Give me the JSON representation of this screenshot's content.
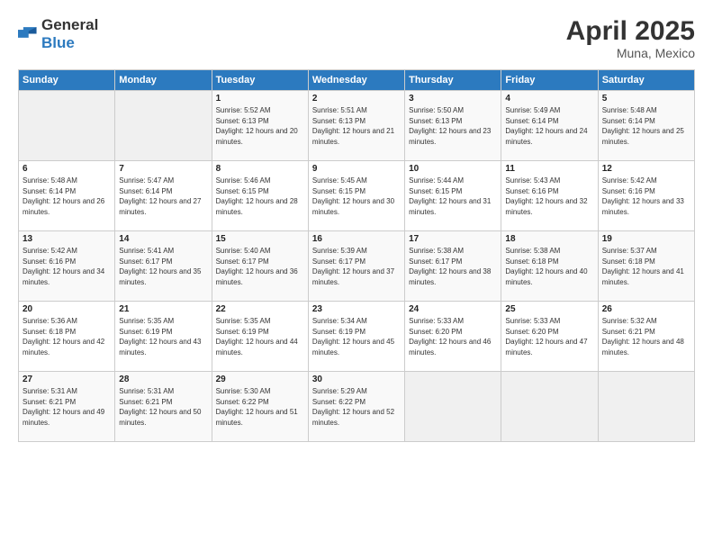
{
  "logo": {
    "general": "General",
    "blue": "Blue"
  },
  "title": {
    "month_year": "April 2025",
    "location": "Muna, Mexico"
  },
  "weekdays": [
    "Sunday",
    "Monday",
    "Tuesday",
    "Wednesday",
    "Thursday",
    "Friday",
    "Saturday"
  ],
  "weeks": [
    [
      null,
      null,
      {
        "day": "1",
        "sunrise": "Sunrise: 5:52 AM",
        "sunset": "Sunset: 6:13 PM",
        "daylight": "Daylight: 12 hours and 20 minutes."
      },
      {
        "day": "2",
        "sunrise": "Sunrise: 5:51 AM",
        "sunset": "Sunset: 6:13 PM",
        "daylight": "Daylight: 12 hours and 21 minutes."
      },
      {
        "day": "3",
        "sunrise": "Sunrise: 5:50 AM",
        "sunset": "Sunset: 6:13 PM",
        "daylight": "Daylight: 12 hours and 23 minutes."
      },
      {
        "day": "4",
        "sunrise": "Sunrise: 5:49 AM",
        "sunset": "Sunset: 6:14 PM",
        "daylight": "Daylight: 12 hours and 24 minutes."
      },
      {
        "day": "5",
        "sunrise": "Sunrise: 5:48 AM",
        "sunset": "Sunset: 6:14 PM",
        "daylight": "Daylight: 12 hours and 25 minutes."
      }
    ],
    [
      {
        "day": "6",
        "sunrise": "Sunrise: 5:48 AM",
        "sunset": "Sunset: 6:14 PM",
        "daylight": "Daylight: 12 hours and 26 minutes."
      },
      {
        "day": "7",
        "sunrise": "Sunrise: 5:47 AM",
        "sunset": "Sunset: 6:14 PM",
        "daylight": "Daylight: 12 hours and 27 minutes."
      },
      {
        "day": "8",
        "sunrise": "Sunrise: 5:46 AM",
        "sunset": "Sunset: 6:15 PM",
        "daylight": "Daylight: 12 hours and 28 minutes."
      },
      {
        "day": "9",
        "sunrise": "Sunrise: 5:45 AM",
        "sunset": "Sunset: 6:15 PM",
        "daylight": "Daylight: 12 hours and 30 minutes."
      },
      {
        "day": "10",
        "sunrise": "Sunrise: 5:44 AM",
        "sunset": "Sunset: 6:15 PM",
        "daylight": "Daylight: 12 hours and 31 minutes."
      },
      {
        "day": "11",
        "sunrise": "Sunrise: 5:43 AM",
        "sunset": "Sunset: 6:16 PM",
        "daylight": "Daylight: 12 hours and 32 minutes."
      },
      {
        "day": "12",
        "sunrise": "Sunrise: 5:42 AM",
        "sunset": "Sunset: 6:16 PM",
        "daylight": "Daylight: 12 hours and 33 minutes."
      }
    ],
    [
      {
        "day": "13",
        "sunrise": "Sunrise: 5:42 AM",
        "sunset": "Sunset: 6:16 PM",
        "daylight": "Daylight: 12 hours and 34 minutes."
      },
      {
        "day": "14",
        "sunrise": "Sunrise: 5:41 AM",
        "sunset": "Sunset: 6:17 PM",
        "daylight": "Daylight: 12 hours and 35 minutes."
      },
      {
        "day": "15",
        "sunrise": "Sunrise: 5:40 AM",
        "sunset": "Sunset: 6:17 PM",
        "daylight": "Daylight: 12 hours and 36 minutes."
      },
      {
        "day": "16",
        "sunrise": "Sunrise: 5:39 AM",
        "sunset": "Sunset: 6:17 PM",
        "daylight": "Daylight: 12 hours and 37 minutes."
      },
      {
        "day": "17",
        "sunrise": "Sunrise: 5:38 AM",
        "sunset": "Sunset: 6:17 PM",
        "daylight": "Daylight: 12 hours and 38 minutes."
      },
      {
        "day": "18",
        "sunrise": "Sunrise: 5:38 AM",
        "sunset": "Sunset: 6:18 PM",
        "daylight": "Daylight: 12 hours and 40 minutes."
      },
      {
        "day": "19",
        "sunrise": "Sunrise: 5:37 AM",
        "sunset": "Sunset: 6:18 PM",
        "daylight": "Daylight: 12 hours and 41 minutes."
      }
    ],
    [
      {
        "day": "20",
        "sunrise": "Sunrise: 5:36 AM",
        "sunset": "Sunset: 6:18 PM",
        "daylight": "Daylight: 12 hours and 42 minutes."
      },
      {
        "day": "21",
        "sunrise": "Sunrise: 5:35 AM",
        "sunset": "Sunset: 6:19 PM",
        "daylight": "Daylight: 12 hours and 43 minutes."
      },
      {
        "day": "22",
        "sunrise": "Sunrise: 5:35 AM",
        "sunset": "Sunset: 6:19 PM",
        "daylight": "Daylight: 12 hours and 44 minutes."
      },
      {
        "day": "23",
        "sunrise": "Sunrise: 5:34 AM",
        "sunset": "Sunset: 6:19 PM",
        "daylight": "Daylight: 12 hours and 45 minutes."
      },
      {
        "day": "24",
        "sunrise": "Sunrise: 5:33 AM",
        "sunset": "Sunset: 6:20 PM",
        "daylight": "Daylight: 12 hours and 46 minutes."
      },
      {
        "day": "25",
        "sunrise": "Sunrise: 5:33 AM",
        "sunset": "Sunset: 6:20 PM",
        "daylight": "Daylight: 12 hours and 47 minutes."
      },
      {
        "day": "26",
        "sunrise": "Sunrise: 5:32 AM",
        "sunset": "Sunset: 6:21 PM",
        "daylight": "Daylight: 12 hours and 48 minutes."
      }
    ],
    [
      {
        "day": "27",
        "sunrise": "Sunrise: 5:31 AM",
        "sunset": "Sunset: 6:21 PM",
        "daylight": "Daylight: 12 hours and 49 minutes."
      },
      {
        "day": "28",
        "sunrise": "Sunrise: 5:31 AM",
        "sunset": "Sunset: 6:21 PM",
        "daylight": "Daylight: 12 hours and 50 minutes."
      },
      {
        "day": "29",
        "sunrise": "Sunrise: 5:30 AM",
        "sunset": "Sunset: 6:22 PM",
        "daylight": "Daylight: 12 hours and 51 minutes."
      },
      {
        "day": "30",
        "sunrise": "Sunrise: 5:29 AM",
        "sunset": "Sunset: 6:22 PM",
        "daylight": "Daylight: 12 hours and 52 minutes."
      },
      null,
      null,
      null
    ]
  ]
}
